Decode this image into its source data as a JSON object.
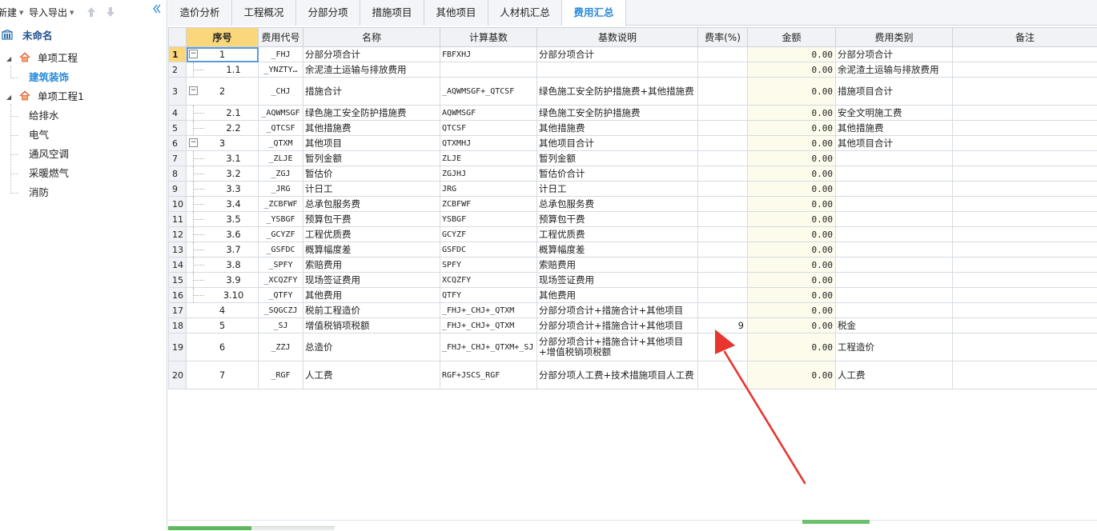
{
  "toolbar": {
    "new_label": "新建",
    "import_export_label": "导入导出"
  },
  "tree": {
    "root": "未命名",
    "items": [
      {
        "label": "单项工程"
      },
      {
        "label": "建筑装饰"
      },
      {
        "label": "单项工程1"
      },
      {
        "label": "给排水"
      },
      {
        "label": "电气"
      },
      {
        "label": "通风空调"
      },
      {
        "label": "采暖燃气"
      },
      {
        "label": "消防"
      }
    ]
  },
  "tabs": [
    "造价分析",
    "工程概况",
    "分部分项",
    "措施项目",
    "其他项目",
    "人材机汇总",
    "费用汇总"
  ],
  "active_tab": "费用汇总",
  "grid": {
    "headers": [
      "序号",
      "费用代号",
      "名称",
      "计算基数",
      "基数说明",
      "费率(%)",
      "金额",
      "费用类别",
      "备注"
    ],
    "rows": [
      {
        "rn": "1",
        "seq": "1",
        "code": "_FHJ",
        "name": "分部分项合计",
        "base": "FBFXHJ",
        "desc": "分部分项合计",
        "rate": "",
        "amount": "0.00",
        "category": "分部分项合计",
        "note": ""
      },
      {
        "rn": "2",
        "seq": "1.1",
        "code": "_YNZTY…",
        "name": "余泥渣土运输与排放费用",
        "base": "",
        "desc": "",
        "rate": "",
        "amount": "0.00",
        "category": "余泥渣土运输与排放费用",
        "note": ""
      },
      {
        "rn": "3",
        "seq": "2",
        "code": "_CHJ",
        "name": "措施合计",
        "base": "_AQWMSGF+_QTCSF",
        "desc": "绿色施工安全防护措施费+其他措施费",
        "rate": "",
        "amount": "0.00",
        "category": "措施项目合计",
        "note": ""
      },
      {
        "rn": "4",
        "seq": "2.1",
        "code": "_AQWMSGF",
        "name": "绿色施工安全防护措施费",
        "base": "AQWMSGF",
        "desc": "绿色施工安全防护措施费",
        "rate": "",
        "amount": "0.00",
        "category": "安全文明施工费",
        "note": ""
      },
      {
        "rn": "5",
        "seq": "2.2",
        "code": "_QTCSF",
        "name": "其他措施费",
        "base": "QTCSF",
        "desc": "其他措施费",
        "rate": "",
        "amount": "0.00",
        "category": "其他措施费",
        "note": ""
      },
      {
        "rn": "6",
        "seq": "3",
        "code": "_QTXM",
        "name": "其他项目",
        "base": "QTXMHJ",
        "desc": "其他项目合计",
        "rate": "",
        "amount": "0.00",
        "category": "其他项目合计",
        "note": ""
      },
      {
        "rn": "7",
        "seq": "3.1",
        "code": "_ZLJE",
        "name": "暂列金额",
        "base": "ZLJE",
        "desc": "暂列金额",
        "rate": "",
        "amount": "0.00",
        "category": "",
        "note": ""
      },
      {
        "rn": "8",
        "seq": "3.2",
        "code": "_ZGJ",
        "name": "暂估价",
        "base": "ZGJHJ",
        "desc": "暂估价合计",
        "rate": "",
        "amount": "0.00",
        "category": "",
        "note": ""
      },
      {
        "rn": "9",
        "seq": "3.3",
        "code": "_JRG",
        "name": "计日工",
        "base": "JRG",
        "desc": "计日工",
        "rate": "",
        "amount": "0.00",
        "category": "",
        "note": ""
      },
      {
        "rn": "10",
        "seq": "3.4",
        "code": "_ZCBFWF",
        "name": "总承包服务费",
        "base": "ZCBFWF",
        "desc": "总承包服务费",
        "rate": "",
        "amount": "0.00",
        "category": "",
        "note": ""
      },
      {
        "rn": "11",
        "seq": "3.5",
        "code": "_YSBGF",
        "name": "预算包干费",
        "base": "YSBGF",
        "desc": "预算包干费",
        "rate": "",
        "amount": "0.00",
        "category": "",
        "note": ""
      },
      {
        "rn": "12",
        "seq": "3.6",
        "code": "_GCYZF",
        "name": "工程优质费",
        "base": "GCYZF",
        "desc": "工程优质费",
        "rate": "",
        "amount": "0.00",
        "category": "",
        "note": ""
      },
      {
        "rn": "13",
        "seq": "3.7",
        "code": "_GSFDC",
        "name": "概算幅度差",
        "base": "GSFDC",
        "desc": "概算幅度差",
        "rate": "",
        "amount": "0.00",
        "category": "",
        "note": ""
      },
      {
        "rn": "14",
        "seq": "3.8",
        "code": "_SPFY",
        "name": "索赔费用",
        "base": "SPFY",
        "desc": "索赔费用",
        "rate": "",
        "amount": "0.00",
        "category": "",
        "note": ""
      },
      {
        "rn": "15",
        "seq": "3.9",
        "code": "_XCQZFY",
        "name": "现场签证费用",
        "base": "XCQZFY",
        "desc": "现场签证费用",
        "rate": "",
        "amount": "0.00",
        "category": "",
        "note": ""
      },
      {
        "rn": "16",
        "seq": "3.10",
        "code": "_QTFY",
        "name": "其他费用",
        "base": "QTFY",
        "desc": "其他费用",
        "rate": "",
        "amount": "0.00",
        "category": "",
        "note": ""
      },
      {
        "rn": "17",
        "seq": "4",
        "code": "_SQGCZJ",
        "name": "税前工程造价",
        "base": "_FHJ+_CHJ+_QTXM",
        "desc": "分部分项合计+措施合计+其他项目",
        "rate": "",
        "amount": "0.00",
        "category": "",
        "note": ""
      },
      {
        "rn": "18",
        "seq": "5",
        "code": "_SJ",
        "name": "增值税销项税额",
        "base": "_FHJ+_CHJ+_QTXM",
        "desc": "分部分项合计+措施合计+其他项目",
        "rate": "9",
        "amount": "0.00",
        "category": "税金",
        "note": ""
      },
      {
        "rn": "19",
        "seq": "6",
        "code": "_ZZJ",
        "name": "总造价",
        "base": "_FHJ+_CHJ+_QTXM+_SJ",
        "desc": "分部分项合计+措施合计+其他项目+增值税销项税额",
        "rate": "",
        "amount": "0.00",
        "category": "工程造价",
        "note": ""
      },
      {
        "rn": "20",
        "seq": "7",
        "code": "_RGF",
        "name": "人工费",
        "base": "RGF+JSCS_RGF",
        "desc": "分部分项人工费+技术措施项目人工费",
        "rate": "",
        "amount": "0.00",
        "category": "人工费",
        "note": ""
      }
    ]
  },
  "colors": {
    "accent": "#2a8bd8",
    "header_selected": "#f9d77a",
    "annotation_arrow": "#e8352e",
    "status_green": "#5cb85c"
  }
}
